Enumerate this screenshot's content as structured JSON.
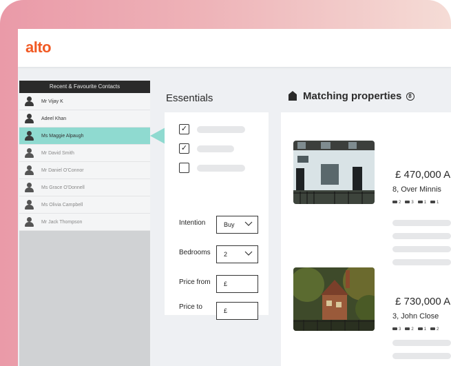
{
  "app": {
    "logo": "alto"
  },
  "sidebar": {
    "header": "Recent & Favourite Contacts",
    "contacts": [
      {
        "name": "Mr Vijay K"
      },
      {
        "name": "Adeel Khan"
      },
      {
        "name": "Ms Maggie Alpaugh"
      },
      {
        "name": "Mr David Smith"
      },
      {
        "name": "Mr Daniel O'Connor"
      },
      {
        "name": "Ms Grace O'Donnell"
      },
      {
        "name": "Ms Olivia Campbell"
      },
      {
        "name": "Mr Jack Thompson"
      }
    ],
    "active_index": 2
  },
  "essentials": {
    "title": "Essentials",
    "checkboxes": [
      {
        "checked": true
      },
      {
        "checked": true
      },
      {
        "checked": false
      }
    ],
    "intention_label": "Intention",
    "intention_value": "Buy",
    "bedrooms_label": "Bedrooms",
    "bedrooms_value": "2",
    "price_from_label": "Price from",
    "price_from_value": "£",
    "price_to_label": "Price to",
    "price_to_value": "£"
  },
  "matching": {
    "title": "Matching properties",
    "count": "8",
    "properties": [
      {
        "price": "£ 470,000 A",
        "address": "8, Over Minnis",
        "beds": "2",
        "baths": "3",
        "receptions": "1",
        "parking": "1"
      },
      {
        "price": "£ 730,000 A",
        "address": "3, John Close",
        "beds": "3",
        "baths": "2",
        "receptions": "1",
        "parking": "2"
      }
    ]
  },
  "colors": {
    "brand": "#f15a24",
    "active_contact": "#8fdad0"
  }
}
